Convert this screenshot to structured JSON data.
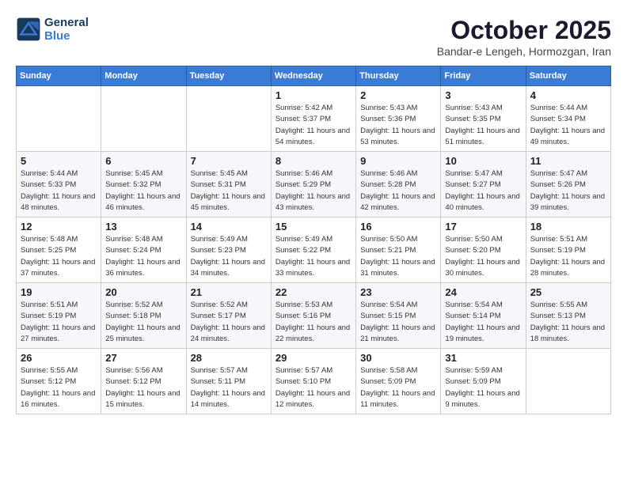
{
  "header": {
    "logo_line1": "General",
    "logo_line2": "Blue",
    "month": "October 2025",
    "location": "Bandar-e Lengeh, Hormozgan, Iran"
  },
  "weekdays": [
    "Sunday",
    "Monday",
    "Tuesday",
    "Wednesday",
    "Thursday",
    "Friday",
    "Saturday"
  ],
  "weeks": [
    [
      {
        "day": "",
        "sunrise": "",
        "sunset": "",
        "daylight": ""
      },
      {
        "day": "",
        "sunrise": "",
        "sunset": "",
        "daylight": ""
      },
      {
        "day": "",
        "sunrise": "",
        "sunset": "",
        "daylight": ""
      },
      {
        "day": "1",
        "sunrise": "Sunrise: 5:42 AM",
        "sunset": "Sunset: 5:37 PM",
        "daylight": "Daylight: 11 hours and 54 minutes."
      },
      {
        "day": "2",
        "sunrise": "Sunrise: 5:43 AM",
        "sunset": "Sunset: 5:36 PM",
        "daylight": "Daylight: 11 hours and 53 minutes."
      },
      {
        "day": "3",
        "sunrise": "Sunrise: 5:43 AM",
        "sunset": "Sunset: 5:35 PM",
        "daylight": "Daylight: 11 hours and 51 minutes."
      },
      {
        "day": "4",
        "sunrise": "Sunrise: 5:44 AM",
        "sunset": "Sunset: 5:34 PM",
        "daylight": "Daylight: 11 hours and 49 minutes."
      }
    ],
    [
      {
        "day": "5",
        "sunrise": "Sunrise: 5:44 AM",
        "sunset": "Sunset: 5:33 PM",
        "daylight": "Daylight: 11 hours and 48 minutes."
      },
      {
        "day": "6",
        "sunrise": "Sunrise: 5:45 AM",
        "sunset": "Sunset: 5:32 PM",
        "daylight": "Daylight: 11 hours and 46 minutes."
      },
      {
        "day": "7",
        "sunrise": "Sunrise: 5:45 AM",
        "sunset": "Sunset: 5:31 PM",
        "daylight": "Daylight: 11 hours and 45 minutes."
      },
      {
        "day": "8",
        "sunrise": "Sunrise: 5:46 AM",
        "sunset": "Sunset: 5:29 PM",
        "daylight": "Daylight: 11 hours and 43 minutes."
      },
      {
        "day": "9",
        "sunrise": "Sunrise: 5:46 AM",
        "sunset": "Sunset: 5:28 PM",
        "daylight": "Daylight: 11 hours and 42 minutes."
      },
      {
        "day": "10",
        "sunrise": "Sunrise: 5:47 AM",
        "sunset": "Sunset: 5:27 PM",
        "daylight": "Daylight: 11 hours and 40 minutes."
      },
      {
        "day": "11",
        "sunrise": "Sunrise: 5:47 AM",
        "sunset": "Sunset: 5:26 PM",
        "daylight": "Daylight: 11 hours and 39 minutes."
      }
    ],
    [
      {
        "day": "12",
        "sunrise": "Sunrise: 5:48 AM",
        "sunset": "Sunset: 5:25 PM",
        "daylight": "Daylight: 11 hours and 37 minutes."
      },
      {
        "day": "13",
        "sunrise": "Sunrise: 5:48 AM",
        "sunset": "Sunset: 5:24 PM",
        "daylight": "Daylight: 11 hours and 36 minutes."
      },
      {
        "day": "14",
        "sunrise": "Sunrise: 5:49 AM",
        "sunset": "Sunset: 5:23 PM",
        "daylight": "Daylight: 11 hours and 34 minutes."
      },
      {
        "day": "15",
        "sunrise": "Sunrise: 5:49 AM",
        "sunset": "Sunset: 5:22 PM",
        "daylight": "Daylight: 11 hours and 33 minutes."
      },
      {
        "day": "16",
        "sunrise": "Sunrise: 5:50 AM",
        "sunset": "Sunset: 5:21 PM",
        "daylight": "Daylight: 11 hours and 31 minutes."
      },
      {
        "day": "17",
        "sunrise": "Sunrise: 5:50 AM",
        "sunset": "Sunset: 5:20 PM",
        "daylight": "Daylight: 11 hours and 30 minutes."
      },
      {
        "day": "18",
        "sunrise": "Sunrise: 5:51 AM",
        "sunset": "Sunset: 5:19 PM",
        "daylight": "Daylight: 11 hours and 28 minutes."
      }
    ],
    [
      {
        "day": "19",
        "sunrise": "Sunrise: 5:51 AM",
        "sunset": "Sunset: 5:19 PM",
        "daylight": "Daylight: 11 hours and 27 minutes."
      },
      {
        "day": "20",
        "sunrise": "Sunrise: 5:52 AM",
        "sunset": "Sunset: 5:18 PM",
        "daylight": "Daylight: 11 hours and 25 minutes."
      },
      {
        "day": "21",
        "sunrise": "Sunrise: 5:52 AM",
        "sunset": "Sunset: 5:17 PM",
        "daylight": "Daylight: 11 hours and 24 minutes."
      },
      {
        "day": "22",
        "sunrise": "Sunrise: 5:53 AM",
        "sunset": "Sunset: 5:16 PM",
        "daylight": "Daylight: 11 hours and 22 minutes."
      },
      {
        "day": "23",
        "sunrise": "Sunrise: 5:54 AM",
        "sunset": "Sunset: 5:15 PM",
        "daylight": "Daylight: 11 hours and 21 minutes."
      },
      {
        "day": "24",
        "sunrise": "Sunrise: 5:54 AM",
        "sunset": "Sunset: 5:14 PM",
        "daylight": "Daylight: 11 hours and 19 minutes."
      },
      {
        "day": "25",
        "sunrise": "Sunrise: 5:55 AM",
        "sunset": "Sunset: 5:13 PM",
        "daylight": "Daylight: 11 hours and 18 minutes."
      }
    ],
    [
      {
        "day": "26",
        "sunrise": "Sunrise: 5:55 AM",
        "sunset": "Sunset: 5:12 PM",
        "daylight": "Daylight: 11 hours and 16 minutes."
      },
      {
        "day": "27",
        "sunrise": "Sunrise: 5:56 AM",
        "sunset": "Sunset: 5:12 PM",
        "daylight": "Daylight: 11 hours and 15 minutes."
      },
      {
        "day": "28",
        "sunrise": "Sunrise: 5:57 AM",
        "sunset": "Sunset: 5:11 PM",
        "daylight": "Daylight: 11 hours and 14 minutes."
      },
      {
        "day": "29",
        "sunrise": "Sunrise: 5:57 AM",
        "sunset": "Sunset: 5:10 PM",
        "daylight": "Daylight: 11 hours and 12 minutes."
      },
      {
        "day": "30",
        "sunrise": "Sunrise: 5:58 AM",
        "sunset": "Sunset: 5:09 PM",
        "daylight": "Daylight: 11 hours and 11 minutes."
      },
      {
        "day": "31",
        "sunrise": "Sunrise: 5:59 AM",
        "sunset": "Sunset: 5:09 PM",
        "daylight": "Daylight: 11 hours and 9 minutes."
      },
      {
        "day": "",
        "sunrise": "",
        "sunset": "",
        "daylight": ""
      }
    ]
  ]
}
